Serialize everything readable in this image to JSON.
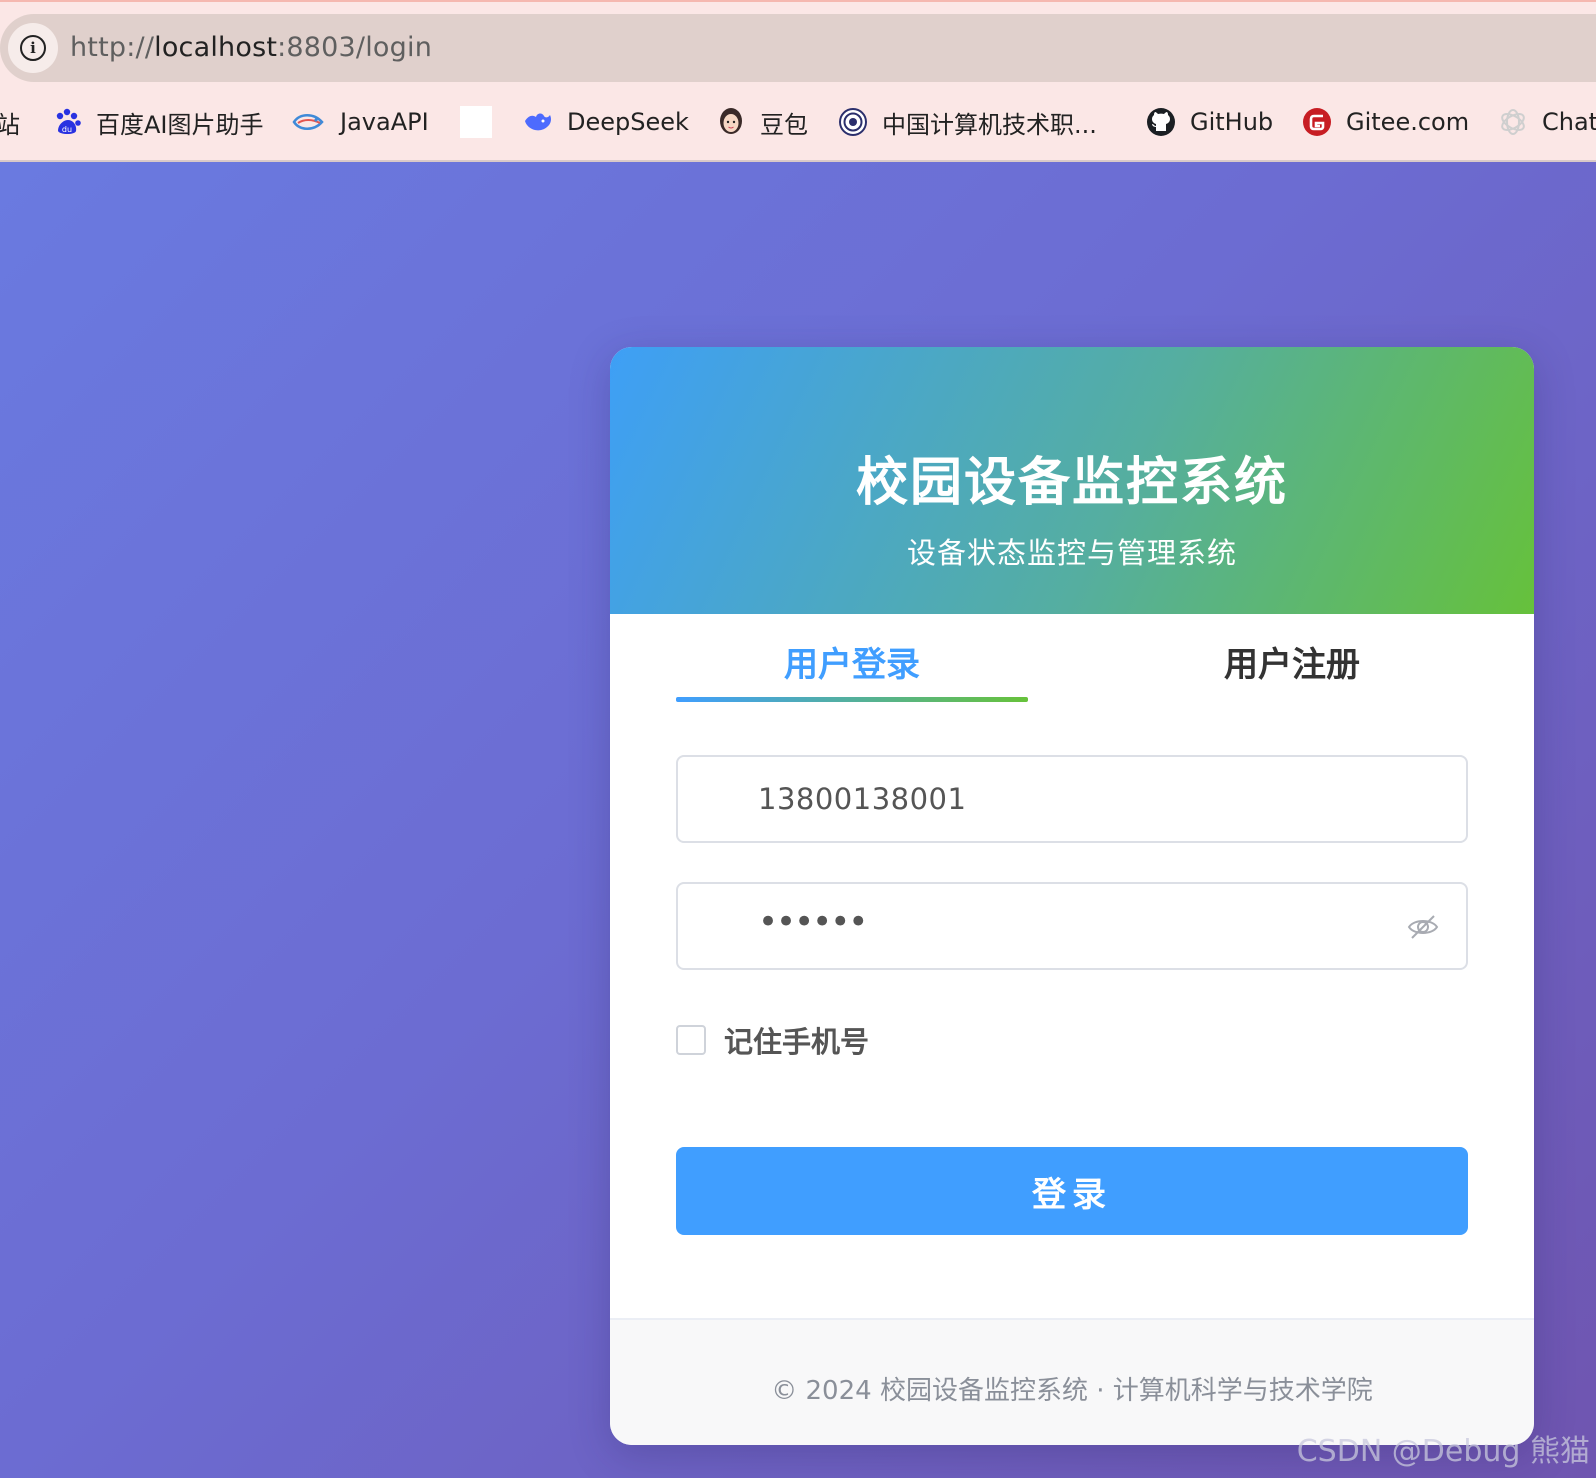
{
  "browser": {
    "url_scheme": "http://",
    "url_host": "localhost",
    "url_path": ":8803/login",
    "bookmarks": [
      {
        "label": "站",
        "icon": "bookmark-partial"
      },
      {
        "label": "百度AI图片助手",
        "icon": "baidu-paw-icon"
      },
      {
        "label": "JavaAPI",
        "icon": "java-fish-icon"
      },
      {
        "label": "",
        "icon": "blank-page-icon"
      },
      {
        "label": "DeepSeek",
        "icon": "deepseek-whale-icon"
      },
      {
        "label": "豆包",
        "icon": "doubao-avatar-icon"
      },
      {
        "label": "中国计算机技术职...",
        "icon": "org-seal-icon"
      },
      {
        "label": "GitHub",
        "icon": "github-icon"
      },
      {
        "label": "Gitee.com",
        "icon": "gitee-icon"
      },
      {
        "label": "Chat",
        "icon": "openai-icon"
      }
    ]
  },
  "card": {
    "title": "校园设备监控系统",
    "subtitle": "设备状态监控与管理系统",
    "tabs": {
      "login": "用户登录",
      "register": "用户注册",
      "active": "login"
    },
    "phone_value": "13800138001",
    "password_masked": "••••••",
    "remember_label": "记住手机号",
    "remember_checked": false,
    "login_button": "登录",
    "footer": "© 2024 校园设备监控系统 · 计算机科学与技术学院"
  },
  "colors": {
    "accent": "#409eff",
    "header_gradient_start": "#3e9ff6",
    "header_gradient_end": "#66c13b",
    "page_background": "#6c72d8"
  },
  "watermark": "CSDN @Debug 熊猫"
}
